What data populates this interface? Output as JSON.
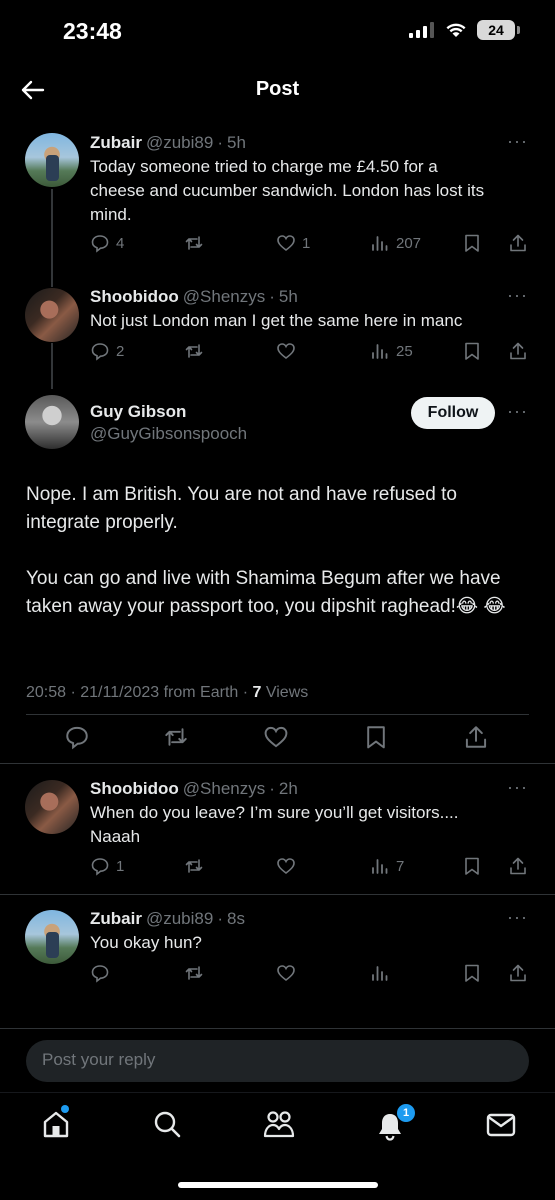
{
  "status_bar": {
    "time": "23:48",
    "battery": "24"
  },
  "header": {
    "title": "Post"
  },
  "tweets": [
    {
      "name": "Zubair",
      "handle": "@zubi89",
      "time": "5h",
      "text_lines": [
        "Today someone tried to charge me £4.50 for a",
        "cheese and cucumber sandwich. London has lost its",
        "mind."
      ],
      "replies": "4",
      "retweets": "",
      "likes": "1",
      "views": "207"
    },
    {
      "name": "Shoobidoo",
      "handle": "@Shenzys",
      "time": "5h",
      "text_lines": [
        "Not just London man I get the same here in manc"
      ],
      "replies": "2",
      "retweets": "",
      "likes": "",
      "views": "25"
    }
  ],
  "main_post": {
    "name": "Guy Gibson",
    "handle": "@GuyGibsonspooch",
    "follow_label": "Follow",
    "paragraph1": "Nope. I am British. You are not and have refused to integrate properly.",
    "paragraph2": "You can go and live with Shamima Begum after we have taken away your passport too, you dipshit raghead!😂 😂",
    "meta_datetime": "20:58 · 21/11/2023 from Earth · ",
    "views_count": "7",
    "views_label": " Views"
  },
  "replies": [
    {
      "name": "Shoobidoo",
      "handle": "@Shenzys",
      "time": "2h",
      "text_lines": [
        "When do you leave? I’m sure you’ll get visitors....",
        "Naaah"
      ],
      "replies": "1",
      "views": "7"
    },
    {
      "name": "Zubair",
      "handle": "@zubi89",
      "time": "8s",
      "text_lines": [
        "You okay hun?"
      ],
      "replies": "",
      "views": ""
    }
  ],
  "reply_box": {
    "placeholder": "Post your reply"
  },
  "tabbar": {
    "notifications_badge": "1"
  },
  "colors": {
    "background": "#000000",
    "accent": "#1d9bf0",
    "muted": "#71767b"
  }
}
